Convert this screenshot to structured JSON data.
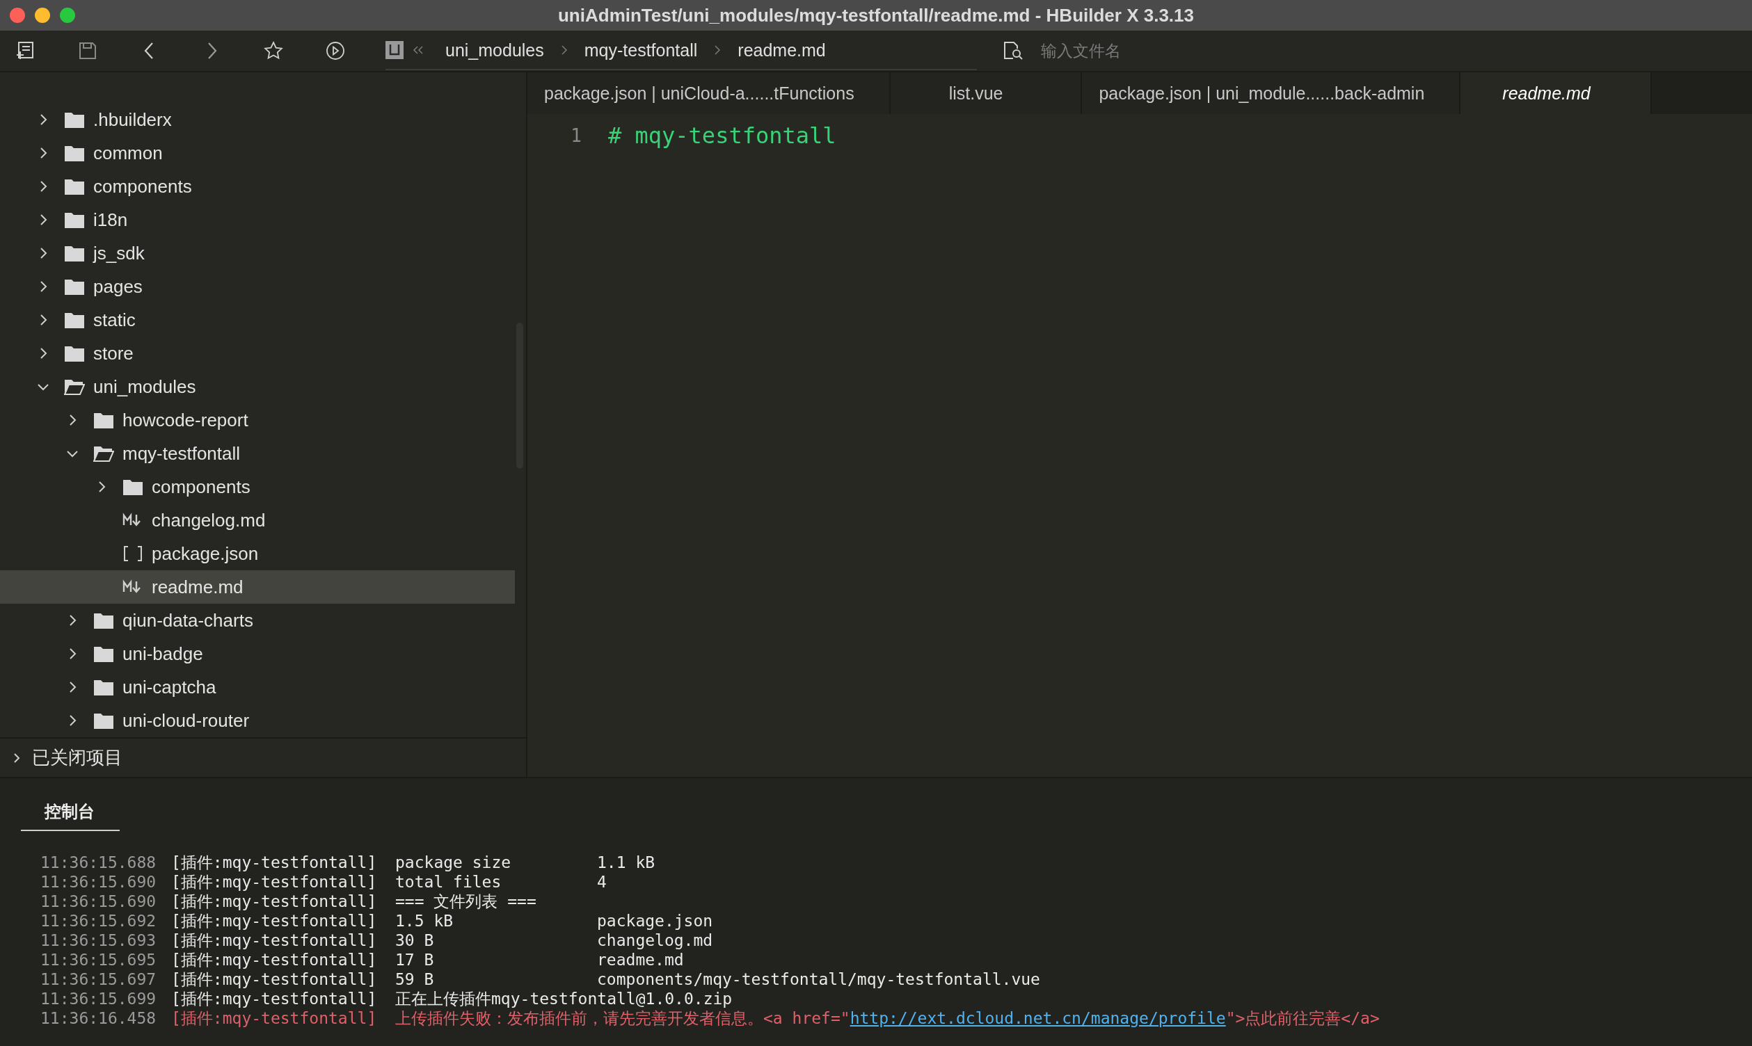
{
  "window": {
    "title": "uniAdminTest/uni_modules/mqy-testfontall/readme.md - HBuilder X 3.3.13"
  },
  "breadcrumb": [
    "uni_modules",
    "mqy-testfontall",
    "readme.md"
  ],
  "search": {
    "placeholder": "输入文件名"
  },
  "tree": [
    {
      "name": ".hbuilderx",
      "kind": "folder",
      "expanded": false,
      "selected": false
    },
    {
      "name": "common",
      "kind": "folder",
      "expanded": false,
      "selected": false
    },
    {
      "name": "components",
      "kind": "folder",
      "expanded": false,
      "selected": false
    },
    {
      "name": "i18n",
      "kind": "folder",
      "expanded": false,
      "selected": false
    },
    {
      "name": "js_sdk",
      "kind": "folder",
      "expanded": false,
      "selected": false
    },
    {
      "name": "pages",
      "kind": "folder",
      "expanded": false,
      "selected": false
    },
    {
      "name": "static",
      "kind": "folder",
      "expanded": false,
      "selected": false
    },
    {
      "name": "store",
      "kind": "folder",
      "expanded": false,
      "selected": false
    },
    {
      "name": "uni_modules",
      "kind": "folder",
      "expanded": true,
      "selected": false,
      "children": [
        {
          "name": "howcode-report",
          "kind": "folder",
          "expanded": false,
          "selected": false
        },
        {
          "name": "mqy-testfontall",
          "kind": "folder",
          "expanded": true,
          "selected": false,
          "children": [
            {
              "name": "components",
              "kind": "folder",
              "expanded": false,
              "selected": false
            },
            {
              "name": "changelog.md",
              "kind": "markdown",
              "selected": false
            },
            {
              "name": "package.json",
              "kind": "json",
              "selected": false
            },
            {
              "name": "readme.md",
              "kind": "markdown",
              "selected": true
            }
          ]
        },
        {
          "name": "qiun-data-charts",
          "kind": "folder",
          "expanded": false,
          "selected": false
        },
        {
          "name": "uni-badge",
          "kind": "folder",
          "expanded": false,
          "selected": false
        },
        {
          "name": "uni-captcha",
          "kind": "folder",
          "expanded": false,
          "selected": false
        },
        {
          "name": "uni-cloud-router",
          "kind": "folder",
          "expanded": false,
          "selected": false
        }
      ]
    }
  ],
  "closed_projects": {
    "label": "已关闭项目",
    "expanded": false
  },
  "tabs": [
    {
      "label": "package.json | uniCloud-a......tFunctions",
      "selected": false,
      "preview": false
    },
    {
      "label": "list.vue",
      "selected": false,
      "preview": false
    },
    {
      "label": "package.json | uni_module......back-admin",
      "selected": false,
      "preview": false
    },
    {
      "label": "readme.md",
      "selected": true,
      "preview": true
    }
  ],
  "editor": {
    "lines": [
      {
        "number": "1",
        "text": "# mqy-testfontall"
      }
    ]
  },
  "console": {
    "tab": {
      "label": "控制台",
      "selected": true
    },
    "lines": [
      {
        "kind": "info",
        "time": "11:36:15.688",
        "tag": "[插件:mqy-testfontall]",
        "message": "package size",
        "detail": "1.1 kB"
      },
      {
        "kind": "info",
        "time": "11:36:15.690",
        "tag": "[插件:mqy-testfontall]",
        "message": "total files",
        "detail": "4"
      },
      {
        "kind": "info",
        "time": "11:36:15.690",
        "tag": "[插件:mqy-testfontall]",
        "message": "=== 文件列表 ==="
      },
      {
        "kind": "info",
        "time": "11:36:15.692",
        "tag": "[插件:mqy-testfontall]",
        "message": "1.5 kB",
        "detail": "package.json"
      },
      {
        "kind": "info",
        "time": "11:36:15.693",
        "tag": "[插件:mqy-testfontall]",
        "message": "30 B",
        "detail": "changelog.md"
      },
      {
        "kind": "info",
        "time": "11:36:15.695",
        "tag": "[插件:mqy-testfontall]",
        "message": "17 B",
        "detail": "readme.md"
      },
      {
        "kind": "info",
        "time": "11:36:15.697",
        "tag": "[插件:mqy-testfontall]",
        "message": "59 B",
        "detail": "components/mqy-testfontall/mqy-testfontall.vue"
      },
      {
        "kind": "info",
        "time": "11:36:15.699",
        "tag": "[插件:mqy-testfontall]",
        "message": "正在上传插件mqy-testfontall@1.0.0.zip"
      },
      {
        "kind": "error",
        "time": "11:36:16.458",
        "tag": "[插件:mqy-testfontall]",
        "message": "上传插件失败：发布插件前，请先完善开发者信息。<a href=\"",
        "link": "http://ext.dcloud.net.cn/manage/profile",
        "message_end": "\">点此前往完善</a>"
      }
    ]
  }
}
